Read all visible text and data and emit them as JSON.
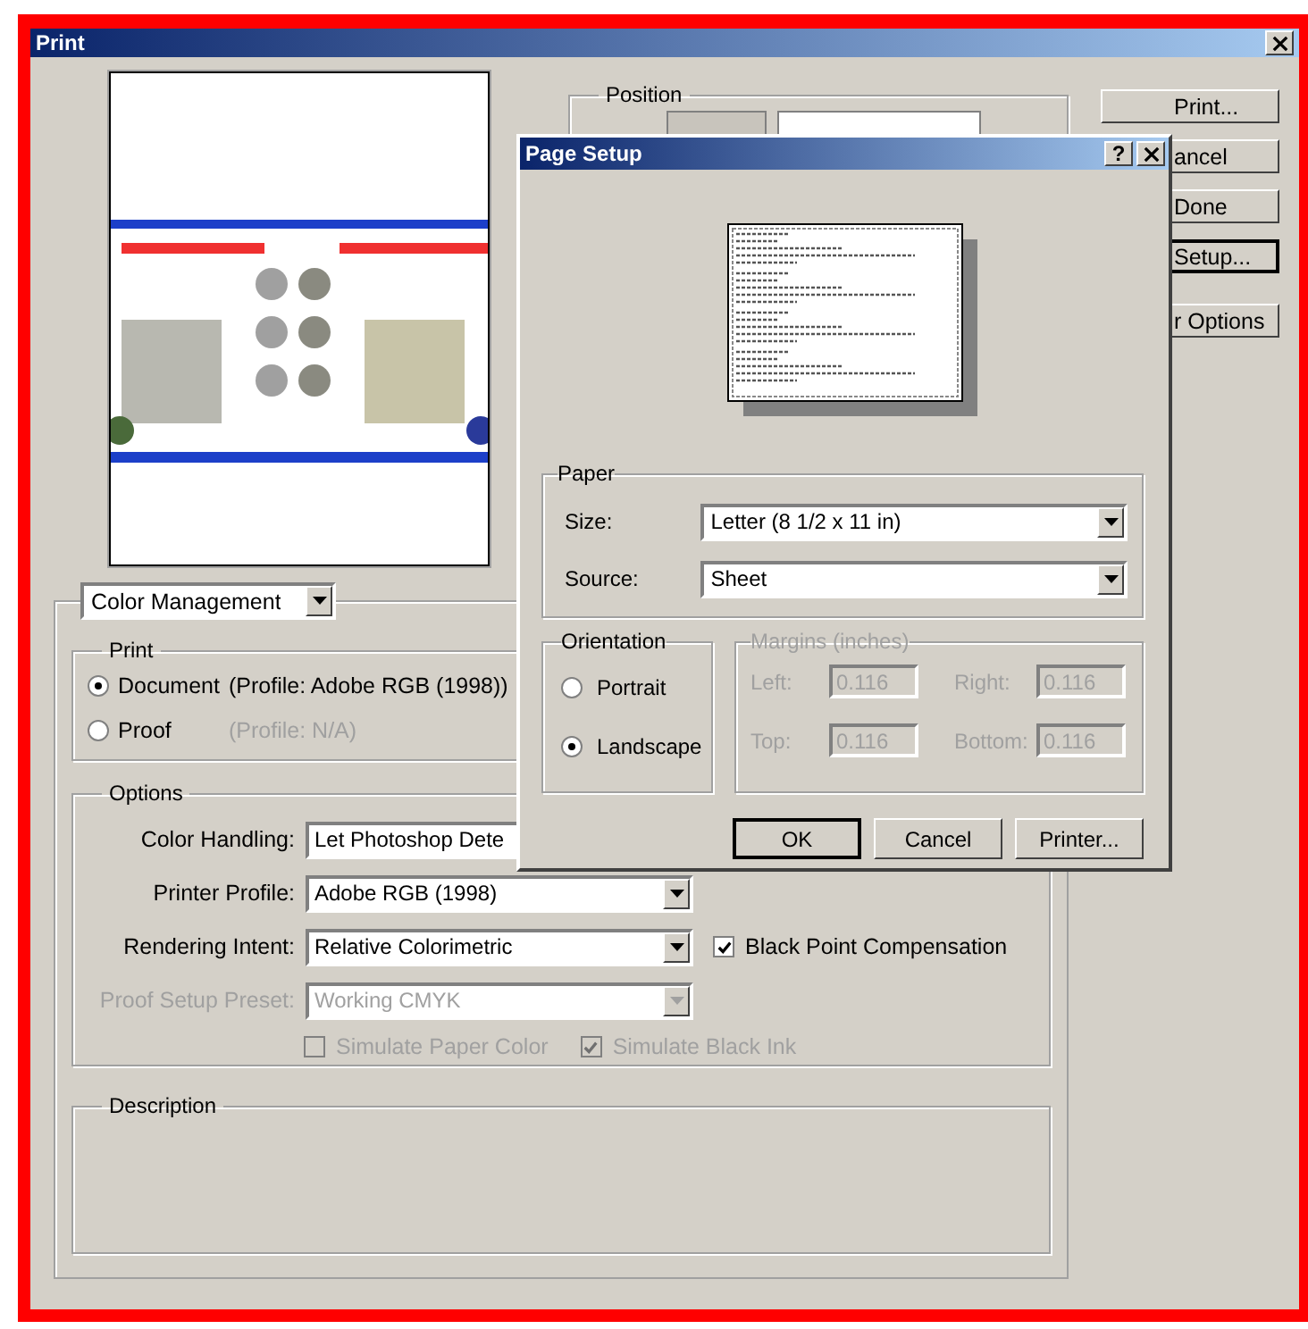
{
  "window": {
    "title": "Print"
  },
  "position": {
    "label": "Position"
  },
  "buttons": [
    {
      "label": "Print...",
      "focused": false
    },
    {
      "label": "ancel",
      "focused": false
    },
    {
      "label": "Done",
      "focused": false
    },
    {
      "label": "Setup...",
      "focused": true
    },
    {
      "label": "r Options",
      "focused": false
    }
  ],
  "section_dropdown": {
    "value": "Color Management"
  },
  "print_group": {
    "label": "Print",
    "options": [
      {
        "label": "Document",
        "profile": "(Profile: Adobe RGB (1998))",
        "profile_disabled": false,
        "selected": true
      },
      {
        "label": "Proof",
        "profile": "(Profile: N/A)",
        "profile_disabled": true,
        "selected": false
      }
    ]
  },
  "options_group": {
    "label": "Options",
    "rows": [
      {
        "kind": "field",
        "label": "Color Handling:",
        "value": "Let Photoshop Dete",
        "disabled": false
      },
      {
        "kind": "dropdown",
        "label": "Printer Profile:",
        "value": "Adobe RGB (1998)",
        "disabled": false
      },
      {
        "kind": "dropdown",
        "label": "Rendering Intent:",
        "value": "Relative Colorimetric",
        "disabled": false,
        "checkbox": {
          "label": "Black Point Compensation",
          "checked": true
        }
      },
      {
        "kind": "dropdown",
        "label": "Proof Setup Preset:",
        "value": "Working CMYK",
        "disabled": true
      }
    ],
    "checkboxes": [
      {
        "label": "Simulate Paper Color",
        "checked": false,
        "disabled": true
      },
      {
        "label": "Simulate Black Ink",
        "checked": true,
        "disabled": true
      }
    ]
  },
  "description": {
    "label": "Description"
  },
  "page_setup": {
    "title": "Page Setup",
    "help_button": "?",
    "paper": {
      "label": "Paper",
      "fields": [
        {
          "label": "Size:",
          "value": "Letter (8 1/2 x 11 in)"
        },
        {
          "label": "Source:",
          "value": "Sheet"
        }
      ]
    },
    "orientation": {
      "label": "Orientation",
      "options": [
        {
          "label": "Portrait",
          "selected": false
        },
        {
          "label": "Landscape",
          "selected": true
        }
      ]
    },
    "margins": {
      "label": "Margins (inches)",
      "disabled": true,
      "fields": [
        {
          "label": "Left:",
          "value": "0.116"
        },
        {
          "label": "Right:",
          "value": "0.116"
        },
        {
          "label": "Top:",
          "value": "0.116"
        },
        {
          "label": "Bottom:",
          "value": "0.116"
        }
      ]
    },
    "buttons": [
      {
        "label": "OK",
        "default": true
      },
      {
        "label": "Cancel",
        "default": false
      },
      {
        "label": "Printer...",
        "default": false
      }
    ]
  }
}
